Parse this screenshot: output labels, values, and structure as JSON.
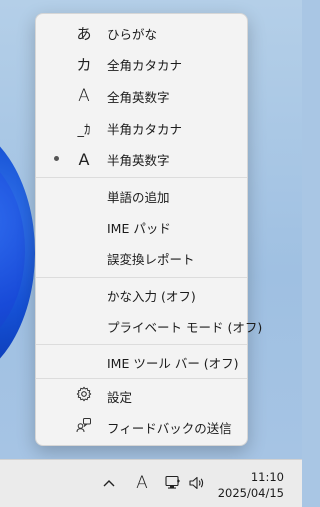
{
  "menu": {
    "items": [
      {
        "icon": "あ",
        "label": "ひらがな",
        "selected": false
      },
      {
        "icon": "カ",
        "label": "全角カタカナ",
        "selected": false
      },
      {
        "icon": "A",
        "label": "全角英数字",
        "selected": false
      },
      {
        "icon": "_ｶ",
        "label": "半角カタカナ",
        "selected": false
      },
      {
        "icon": "A",
        "label": "半角英数字",
        "selected": true
      },
      {
        "label": "単語の追加"
      },
      {
        "label": "IME パッド"
      },
      {
        "label": "誤変換レポート"
      },
      {
        "label": "かな入力 (オフ)"
      },
      {
        "label": "プライベート モード (オフ)"
      },
      {
        "label": "IME ツール バー (オフ)"
      },
      {
        "icon": "⚙",
        "icon_name": "gear-icon",
        "label": "設定"
      },
      {
        "icon": "feedback",
        "icon_name": "feedback-icon",
        "label": "フィードバックの送信"
      }
    ]
  },
  "taskbar": {
    "chevron_icon": "chevron-up-icon",
    "ime_indicator": "A",
    "network_icon": "network-icon",
    "volume_icon": "volume-icon",
    "time": "11:10",
    "date": "2025/04/15"
  }
}
